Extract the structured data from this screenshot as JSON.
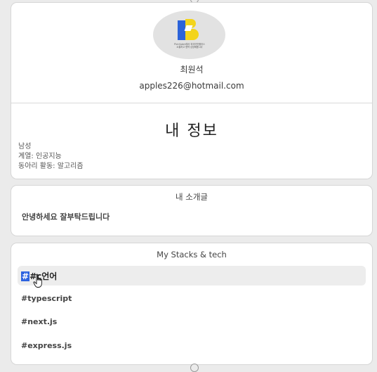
{
  "profile": {
    "logo_text": "Pick Kpkm에서 외국어맛플러스\n소통하고 협력 성장해봅시다",
    "name": "최원석",
    "email": "apples226@hotmail.com"
  },
  "my_info": {
    "title": "내 정보",
    "gender": "남성",
    "major": "계열: 인공지능",
    "club": "동아리 활동: 알고리즘"
  },
  "intro": {
    "title": "내 소개글",
    "text": "안녕하세요 잘부탁드립니다"
  },
  "stacks": {
    "title": "My Stacks & tech",
    "active_selected": "#",
    "active_rest": "#c언어",
    "items": [
      "#typescript",
      "#next.js",
      "#express.js"
    ]
  },
  "colors": {
    "logo_blue": "#2c63d9",
    "logo_yellow": "#f3d41c",
    "selection": "#2d63e0"
  }
}
